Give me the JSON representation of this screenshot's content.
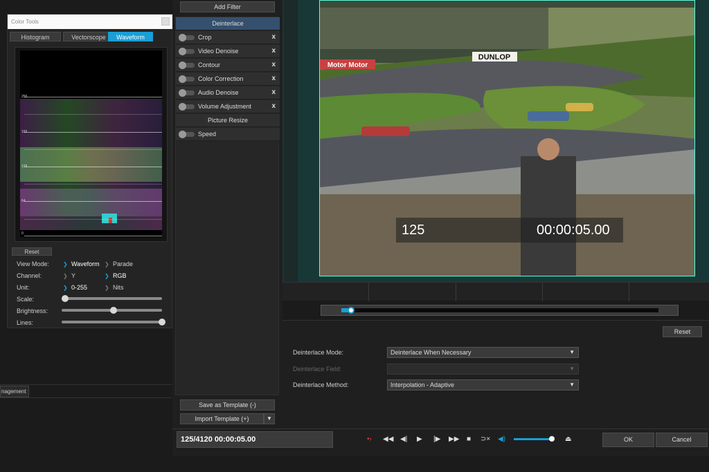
{
  "color_tools": {
    "title": "Color Tools",
    "tabs": [
      "Histogram",
      "Vectorscope",
      "Waveform"
    ],
    "active_tab": "Waveform",
    "scope_ticks": [
      "255",
      "192",
      "128",
      "64",
      "0"
    ],
    "reset_label": "Reset",
    "view_mode": {
      "label": "View Mode:",
      "options": [
        "Waveform",
        "Parade"
      ],
      "selected": "Waveform"
    },
    "channel": {
      "label": "Channel:",
      "options": [
        "Y",
        "RGB"
      ],
      "selected": "RGB"
    },
    "unit": {
      "label": "Unit:",
      "options": [
        "0-255",
        "Nits"
      ],
      "selected": "0-255"
    },
    "scale": {
      "label": "Scale:",
      "value": 0.0
    },
    "brightness": {
      "label": "Brightness:",
      "value": 0.5
    },
    "lines": {
      "label": "Lines:",
      "value": 1.0
    }
  },
  "left_bottom": {
    "tab_label": "nagement"
  },
  "filters": {
    "add_label": "Add Filter",
    "items": [
      {
        "label": "Deinterlace",
        "toggle": false,
        "removable": false,
        "selected": true
      },
      {
        "label": "Crop",
        "toggle": true,
        "removable": true,
        "selected": false
      },
      {
        "label": "Video Denoise",
        "toggle": true,
        "removable": true,
        "selected": false
      },
      {
        "label": "Contour",
        "toggle": true,
        "removable": true,
        "selected": false
      },
      {
        "label": "Color Correction",
        "toggle": true,
        "removable": true,
        "selected": false
      },
      {
        "label": "Audio Denoise",
        "toggle": true,
        "removable": true,
        "selected": false
      },
      {
        "label": "Volume Adjustment",
        "toggle": true,
        "removable": true,
        "selected": false
      },
      {
        "label": "Picture Resize",
        "toggle": false,
        "removable": false,
        "selected": false
      },
      {
        "label": "Speed",
        "toggle": true,
        "removable": false,
        "selected": false
      }
    ],
    "remove_glyph": "x",
    "save_template": "Save as Template (-)",
    "import_template": "Import Template (+)",
    "import_arrow": "▼"
  },
  "preview": {
    "frame_number": "125",
    "timecode": "00:00:05.00",
    "scene_signs": [
      "DUNLOP",
      "Motor  Motor"
    ]
  },
  "timeline": {
    "position": 0.02
  },
  "settings": {
    "reset_label": "Reset",
    "mode": {
      "label": "Deinterlace Mode:",
      "value": "Deinterlace When Necessary"
    },
    "field": {
      "label": "Deinterlace Field:",
      "value": ""
    },
    "method": {
      "label": "Deinterlace Method:",
      "value": "Interpolation - Adaptive"
    }
  },
  "transport": {
    "time_display": "125/4120  00:00:05.00",
    "volume": 0.95,
    "ok_label": "OK",
    "cancel_label": "Cancel"
  },
  "colors": {
    "accent": "#1a9fd6",
    "selected_filter": "#35506e"
  }
}
